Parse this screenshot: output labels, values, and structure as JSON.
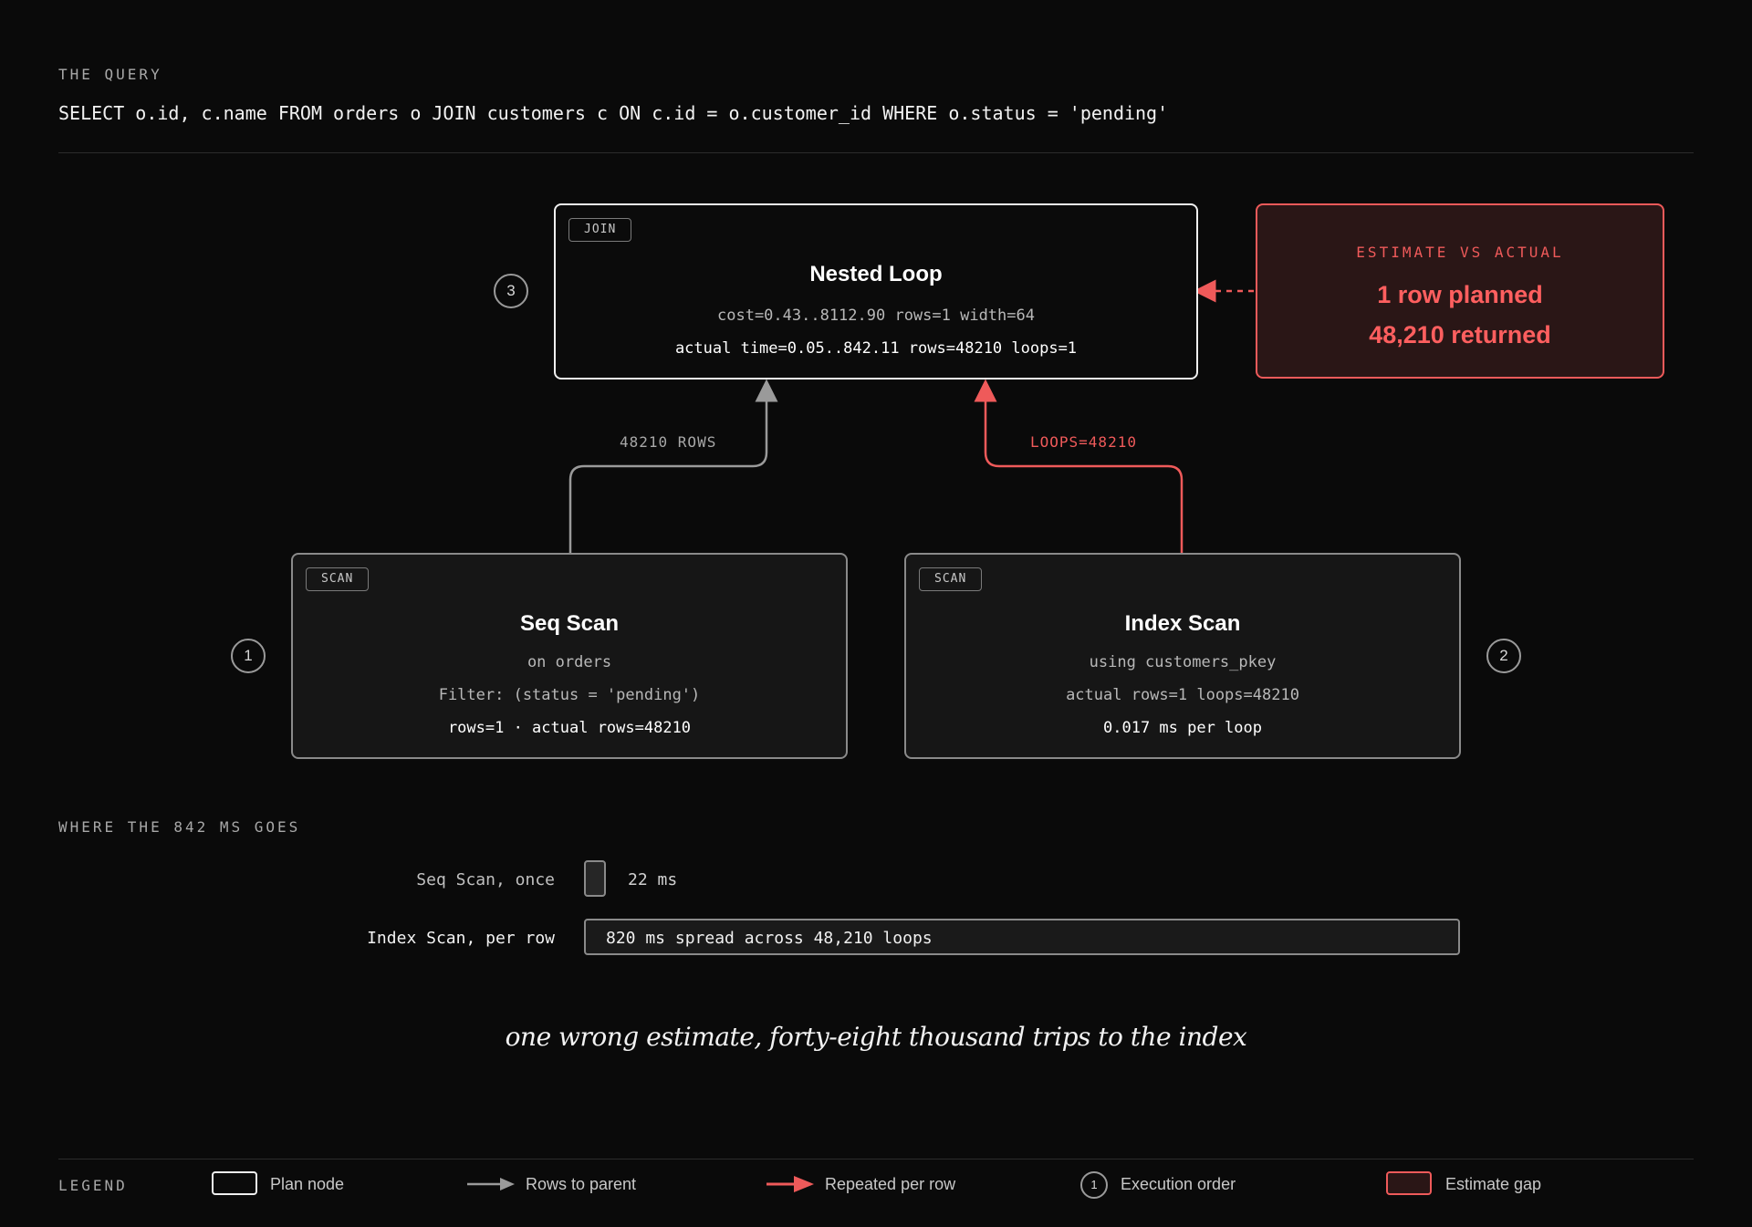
{
  "query": {
    "label": "THE QUERY",
    "sql": "SELECT o.id, c.name FROM orders o JOIN customers c ON c.id = o.customer_id WHERE o.status = 'pending'"
  },
  "plan": {
    "join": {
      "tag": "JOIN",
      "title": "Nested Loop",
      "cost": "cost=0.43..8112.90 rows=1 width=64",
      "actual": "actual time=0.05..842.11 rows=48210 loops=1",
      "order": "3"
    },
    "seq_scan": {
      "tag": "SCAN",
      "title": "Seq Scan",
      "on": "on orders",
      "filter": "Filter: (status = 'pending')",
      "rows": "rows=1 · actual rows=48210",
      "order": "1"
    },
    "index_scan": {
      "tag": "SCAN",
      "title": "Index Scan",
      "using": "using customers_pkey",
      "actual": "actual rows=1 loops=48210",
      "per_loop": "0.017 ms per loop",
      "order": "2"
    },
    "edges": {
      "rows_label": "48210 ROWS",
      "loops_label": "LOOPS=48210"
    },
    "estimate": {
      "label": "ESTIMATE VS ACTUAL",
      "planned": "1 row planned",
      "returned": "48,210 returned"
    }
  },
  "timing": {
    "label": "WHERE THE 842 MS GOES",
    "rows": [
      {
        "name": "Seq Scan, once",
        "value_text": "22 ms",
        "ms": 22
      },
      {
        "name": "Index Scan, per row",
        "value_text": "820 ms spread across 48,210 loops",
        "ms": 820
      }
    ]
  },
  "caption": "one wrong estimate, forty-eight thousand trips to the index",
  "legend": {
    "label": "LEGEND",
    "plan_node": "Plan node",
    "rows_to_parent": "Rows to parent",
    "repeated_per_row": "Repeated per row",
    "execution_order": "Execution order",
    "execution_order_sample": "1",
    "estimate_gap": "Estimate gap"
  },
  "colors": {
    "background": "#0a0a0a",
    "accent_red": "#ef5a5a",
    "edge_gray": "#9a9a9a",
    "node_border": "#8a8a8a"
  }
}
